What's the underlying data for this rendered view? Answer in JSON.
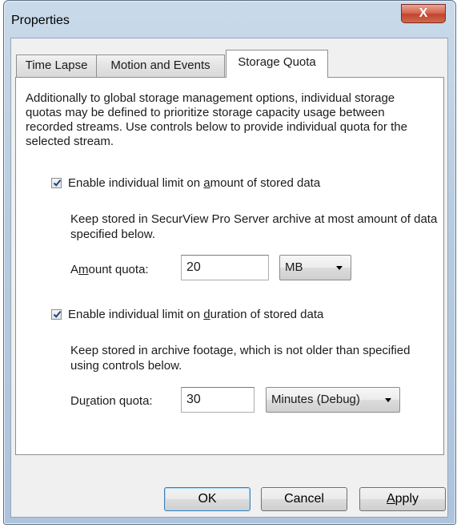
{
  "window": {
    "title": "Properties",
    "close_glyph": "X"
  },
  "tabs": [
    {
      "label": "Time Lapse",
      "active": false
    },
    {
      "label": "Motion and Events",
      "active": false
    },
    {
      "label": "Storage Quota",
      "active": true
    }
  ],
  "storage_quota": {
    "description": "Additionally to global storage management options, individual storage quotas may be defined to prioritize storage capacity usage between recorded streams. Use controls below to provide individual quota for the selected stream.",
    "amount": {
      "checkbox_label_pre": "Enable individual limit on ",
      "checkbox_label_mnemonic": "a",
      "checkbox_label_post": "mount of stored data",
      "checked": true,
      "hint": "Keep stored in SecurView Pro Server archive at most amount of data specified below.",
      "field_label_pre": "A",
      "field_label_mnemonic": "m",
      "field_label_post": "ount quota:",
      "value": "20",
      "unit": "MB"
    },
    "duration": {
      "checkbox_label_pre": "Enable individual limit on ",
      "checkbox_label_mnemonic": "d",
      "checkbox_label_post": "uration of stored data",
      "checked": true,
      "hint": "Keep stored in archive footage, which is not older than specified using controls below.",
      "field_label_pre": "Du",
      "field_label_mnemonic": "r",
      "field_label_post": "ation quota:",
      "value": "30",
      "unit": "Minutes (Debug)"
    }
  },
  "buttons": {
    "ok": "OK",
    "cancel": "Cancel",
    "apply_mnemonic": "A",
    "apply_rest": "pply"
  },
  "colors": {
    "frame": "#b7cbe0",
    "close": "#c2452e",
    "default_button_border": "#3c7fb1"
  }
}
